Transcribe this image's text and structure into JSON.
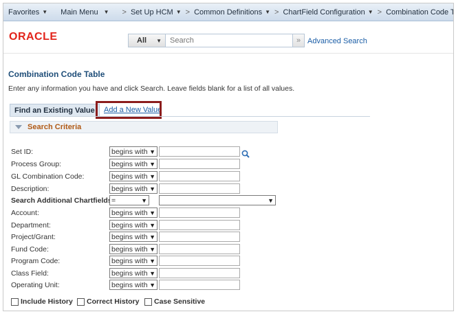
{
  "nav": {
    "favorites": "Favorites",
    "main_menu": "Main Menu",
    "breadcrumbs": [
      "Set Up HCM",
      "Common Definitions",
      "ChartField Configuration",
      "Combination Code Table"
    ]
  },
  "header": {
    "logo": "ORACLE",
    "scope": "All",
    "search_placeholder": "Search",
    "go_symbol": "»",
    "advanced_search": "Advanced Search"
  },
  "page": {
    "title": "Combination Code Table",
    "instructions": "Enter any information you have and click Search. Leave fields blank for a list of all values.",
    "tabs": [
      "Find an Existing Value",
      "Add a New Value"
    ],
    "section_title": "Search Criteria"
  },
  "fields": [
    {
      "label": "Set ID:",
      "operator": "begins with",
      "value": ""
    },
    {
      "label": "Process Group:",
      "operator": "begins with",
      "value": ""
    },
    {
      "label": "GL Combination Code:",
      "operator": "begins with",
      "value": ""
    },
    {
      "label": "Description:",
      "operator": "begins with",
      "value": ""
    },
    {
      "label": "Search Additional Chartfields:",
      "operator": "=",
      "value": ""
    },
    {
      "label": "Account:",
      "operator": "begins with",
      "value": ""
    },
    {
      "label": "Department:",
      "operator": "begins with",
      "value": ""
    },
    {
      "label": "Project/Grant:",
      "operator": "begins with",
      "value": ""
    },
    {
      "label": "Fund Code:",
      "operator": "begins with",
      "value": ""
    },
    {
      "label": "Program Code:",
      "operator": "begins with",
      "value": ""
    },
    {
      "label": "Class Field:",
      "operator": "begins with",
      "value": ""
    },
    {
      "label": "Operating Unit:",
      "operator": "begins with",
      "value": ""
    }
  ],
  "checkboxes": [
    "Include History",
    "Correct History",
    "Case Sensitive"
  ],
  "colors": {
    "accent_red": "#e2231a",
    "title_blue": "#1f4e79",
    "link_blue": "#1a5da6",
    "section_orange": "#b05a16",
    "highlight": "#8b1c1c"
  }
}
